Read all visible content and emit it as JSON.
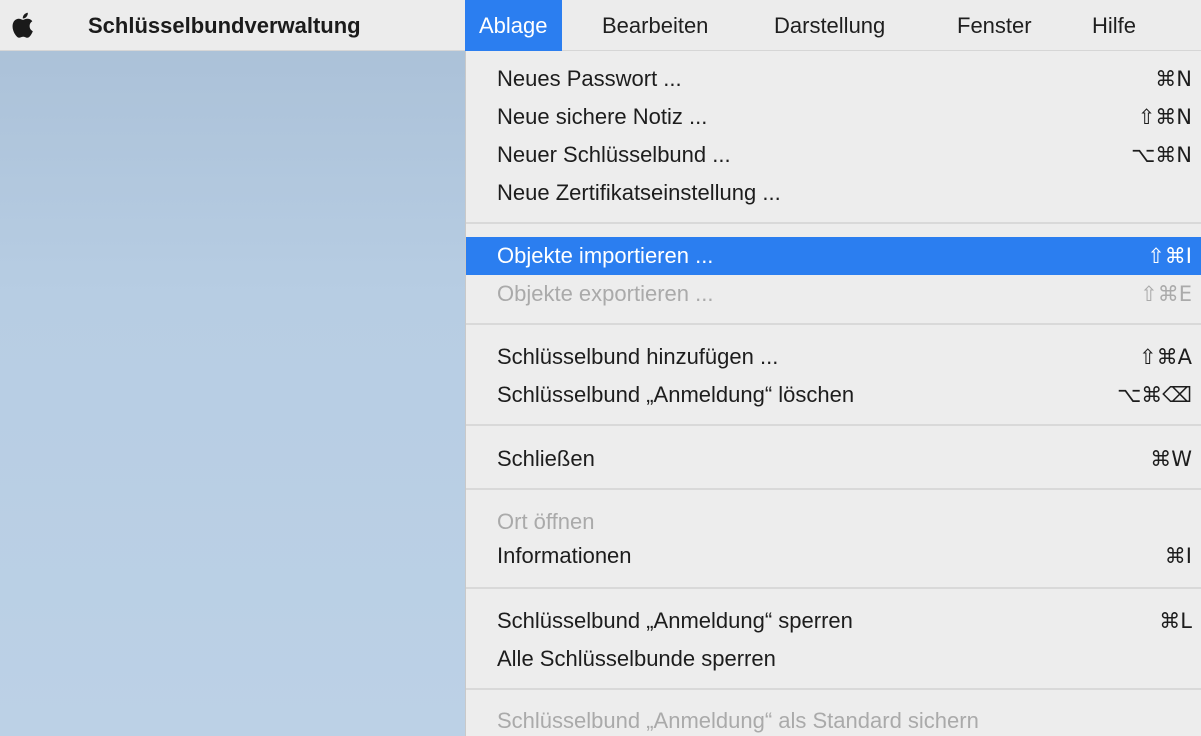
{
  "menubar": {
    "app_name": "Schlüsselbundverwaltung",
    "menus": [
      "Ablage",
      "Bearbeiten",
      "Darstellung",
      "Fenster",
      "Hilfe"
    ],
    "active_menu": "Ablage",
    "apple_icon": "apple-logo-icon"
  },
  "dropdown": {
    "items": [
      {
        "label": "Neues Passwort ...",
        "shortcut": "⌘N",
        "enabled": true
      },
      {
        "label": "Neue sichere Notiz ...",
        "shortcut": "⇧⌘N",
        "enabled": true
      },
      {
        "label": "Neuer Schlüsselbund ...",
        "shortcut": "⌥⌘N",
        "enabled": true
      },
      {
        "label": "Neue Zertifikatseinstellung ...",
        "shortcut": "",
        "enabled": true
      },
      {
        "label": "Objekte importieren ...",
        "shortcut": "⇧⌘I",
        "enabled": true,
        "highlighted": true
      },
      {
        "label": "Objekte exportieren ...",
        "shortcut": "⇧⌘E",
        "enabled": false
      },
      {
        "label": "Schlüsselbund hinzufügen ...",
        "shortcut": "⇧⌘A",
        "enabled": true
      },
      {
        "label": "Schlüsselbund „Anmeldung“ löschen",
        "shortcut": "⌥⌘⌫",
        "enabled": true
      },
      {
        "label": "Schließen",
        "shortcut": "⌘W",
        "enabled": true
      },
      {
        "label": "Ort öffnen",
        "shortcut": "",
        "enabled": false
      },
      {
        "label": "Informationen",
        "shortcut": "⌘I",
        "enabled": true
      },
      {
        "label": "Schlüsselbund „Anmeldung“ sperren",
        "shortcut": "⌘L",
        "enabled": true
      },
      {
        "label": "Alle Schlüsselbunde sperren",
        "shortcut": "",
        "enabled": true
      },
      {
        "label": "Schlüsselbund „Anmeldung“ als Standard sichern",
        "shortcut": "",
        "enabled": false
      }
    ]
  },
  "colors": {
    "highlight": "#2b7ef0",
    "disabled_text": "#aaaaaa",
    "menu_background": "#ededed",
    "desktop": "#b7cde3"
  }
}
